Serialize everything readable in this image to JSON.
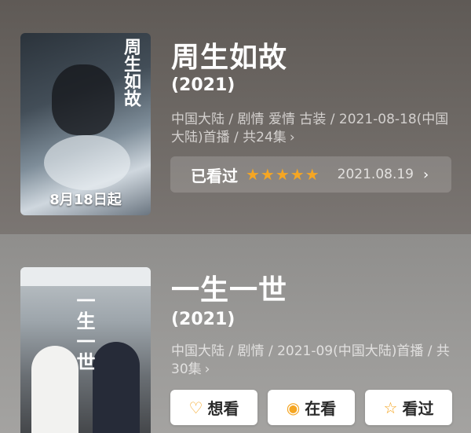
{
  "items": [
    {
      "title": "周生如故",
      "year": "(2021)",
      "meta": "中国大陆 / 剧情 爱情 古装 / 2021-08-18(中国大陆)首播 / 共24集",
      "poster": {
        "vertical_title": "周生如故",
        "date_text": "8月18日起"
      },
      "watched": {
        "label": "已看过",
        "rating": 5,
        "stars_text": "★★★★★",
        "date": "2021.08.19"
      }
    },
    {
      "title": "一生一世",
      "year": "(2021)",
      "meta": "中国大陆 / 剧情 / 2021-09(中国大陆)首播 / 共30集",
      "poster": {
        "vertical_title": "一生一世"
      },
      "actions": [
        {
          "label": "想看",
          "icon": "heart-plus-icon"
        },
        {
          "label": "在看",
          "icon": "circle-dot-icon"
        },
        {
          "label": "看过",
          "icon": "star-outline-icon"
        }
      ]
    }
  ],
  "colors": {
    "accent": "#f5a623",
    "card1_bg": "#6b6662",
    "card2_bg": "#9a9997"
  },
  "chevron": "›"
}
